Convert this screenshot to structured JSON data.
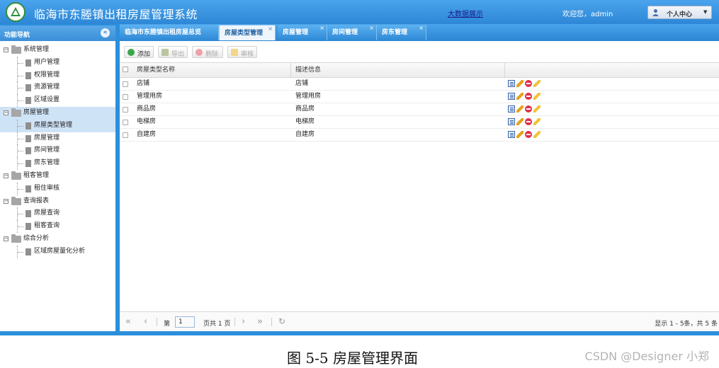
{
  "header": {
    "title": "临海市东塍镇出租房屋管理系统",
    "bigdata_link": "大数据展示",
    "welcome": "欢迎您，admin",
    "user_menu": "个人中心"
  },
  "sidebar": {
    "title": "功能导航",
    "tree": [
      {
        "label": "系统管理",
        "level": 0,
        "expanded": true
      },
      {
        "label": "用户管理",
        "level": 1
      },
      {
        "label": "权限管理",
        "level": 1
      },
      {
        "label": "资源管理",
        "level": 1
      },
      {
        "label": "区域设置",
        "level": 1
      },
      {
        "label": "房屋管理",
        "level": 0,
        "expanded": true,
        "selected": true
      },
      {
        "label": "房屋类型管理",
        "level": 1,
        "selected": true
      },
      {
        "label": "房屋管理",
        "level": 1
      },
      {
        "label": "房间管理",
        "level": 1
      },
      {
        "label": "房东管理",
        "level": 1
      },
      {
        "label": "租客管理",
        "level": 0,
        "expanded": true
      },
      {
        "label": "租住审核",
        "level": 1
      },
      {
        "label": "查询报表",
        "level": 0,
        "expanded": true
      },
      {
        "label": "房屋查询",
        "level": 1
      },
      {
        "label": "租客查询",
        "level": 1
      },
      {
        "label": "综合分析",
        "level": 0,
        "expanded": true
      },
      {
        "label": "区域房屋量化分析",
        "level": 1
      }
    ]
  },
  "tabs": [
    {
      "label": "临海市东塍镇出租房屋总览",
      "closable": false
    },
    {
      "label": "房屋类型管理",
      "closable": true,
      "active": true
    },
    {
      "label": "房屋管理",
      "closable": true
    },
    {
      "label": "房间管理",
      "closable": true
    },
    {
      "label": "房东管理",
      "closable": true
    }
  ],
  "toolbar": {
    "add": "添加",
    "export": "导出",
    "delete": "删除",
    "audit": "审核"
  },
  "grid": {
    "columns": [
      "房屋类型名称",
      "描述信息",
      ""
    ],
    "rows": [
      {
        "name": "店铺",
        "desc": "店铺"
      },
      {
        "name": "管理用房",
        "desc": "管理用房"
      },
      {
        "name": "商品房",
        "desc": "商品房"
      },
      {
        "name": "电梯房",
        "desc": "电梯房"
      },
      {
        "name": "自建房",
        "desc": "自建房"
      }
    ],
    "row_actions": [
      "detail-icon",
      "edit-icon",
      "delete-icon",
      "audit-icon"
    ]
  },
  "pager": {
    "page_label": "第",
    "page_value": "1",
    "total_label": "页共 1 页",
    "info": "显示 1 - 5条，共 5 条"
  },
  "caption": "图  5-5 房屋管理界面",
  "watermark": "CSDN @Designer 小郑"
}
